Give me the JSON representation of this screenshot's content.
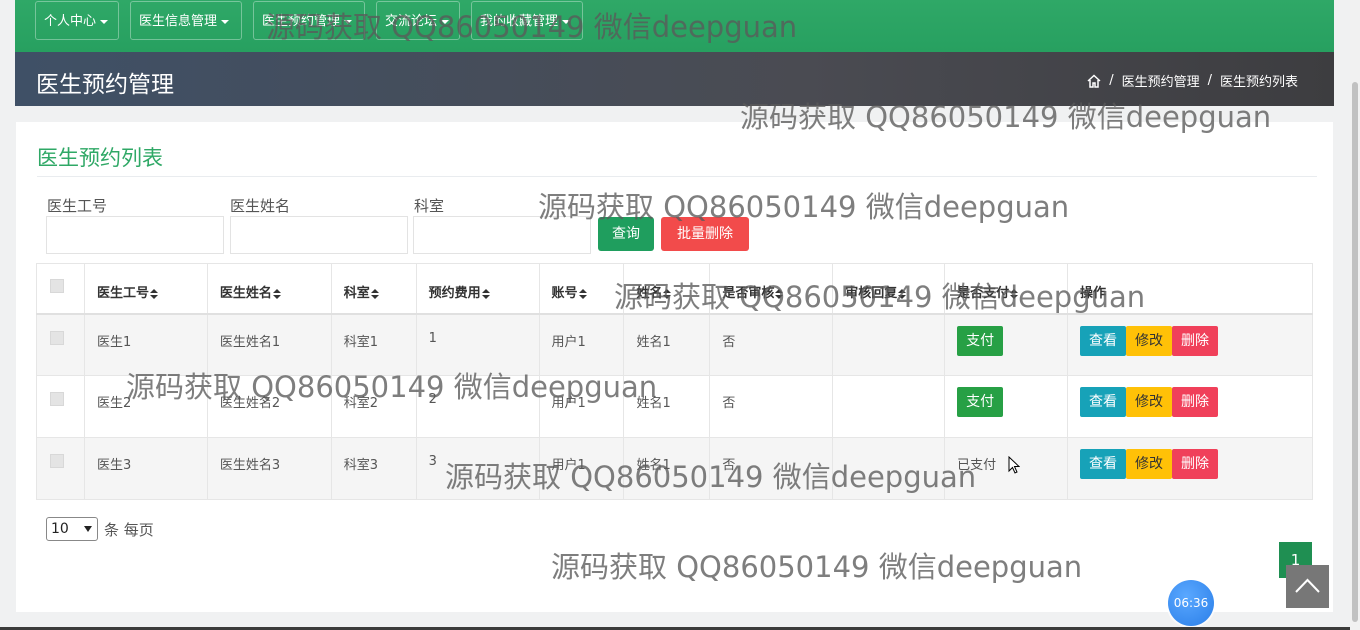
{
  "top_nav": {
    "items": [
      {
        "label": "个人中心"
      },
      {
        "label": "医生信息管理"
      },
      {
        "label": "医生预约管理"
      },
      {
        "label": "交流论坛"
      },
      {
        "label": "我的收藏管理"
      }
    ]
  },
  "page_header": {
    "title": "医生预约管理",
    "breadcrumb": {
      "home_icon": "home-icon",
      "sep": "/",
      "level1": "医生预约管理",
      "level2": "医生预约列表"
    }
  },
  "card": {
    "title": "医生预约列表",
    "filters": [
      {
        "label": "医生工号",
        "value": ""
      },
      {
        "label": "医生姓名",
        "value": ""
      },
      {
        "label": "科室",
        "value": ""
      }
    ],
    "query_label": "查询",
    "bulk_delete_label": "批量删除"
  },
  "table": {
    "columns": [
      "医生工号",
      "医生姓名",
      "科室",
      "预约费用",
      "账号",
      "姓名",
      "是否审核",
      "审核回复",
      "是否支付",
      "操作"
    ],
    "rows": [
      {
        "doctor_id": "医生1",
        "doctor_name": "医生姓名1",
        "department": "科室1",
        "fee": "1",
        "account": "用户1",
        "name": "姓名1",
        "reviewed": "否",
        "reply": "",
        "pay_label": "支付",
        "paid_text": ""
      },
      {
        "doctor_id": "医生2",
        "doctor_name": "医生姓名2",
        "department": "科室2",
        "fee": "2",
        "account": "用户1",
        "name": "姓名1",
        "reviewed": "否",
        "reply": "",
        "pay_label": "支付",
        "paid_text": ""
      },
      {
        "doctor_id": "医生3",
        "doctor_name": "医生姓名3",
        "department": "科室3",
        "fee": "3",
        "account": "用户1",
        "name": "姓名1",
        "reviewed": "否",
        "reply": "",
        "pay_label": "",
        "paid_text": "已支付"
      }
    ],
    "actions": {
      "view": "查看",
      "edit": "修改",
      "delete": "删除"
    }
  },
  "pager": {
    "page_size": "10",
    "per_page_text": "条 每页",
    "current_page": "1"
  },
  "clock": {
    "time": "06:36"
  },
  "watermark": "源码获取 QQ86050149 微信deepguan",
  "colors": {
    "accent_green": "#2fa866",
    "danger_red": "#f24b4b",
    "info_teal": "#17a2b8",
    "warning_yellow": "#ffc107"
  }
}
